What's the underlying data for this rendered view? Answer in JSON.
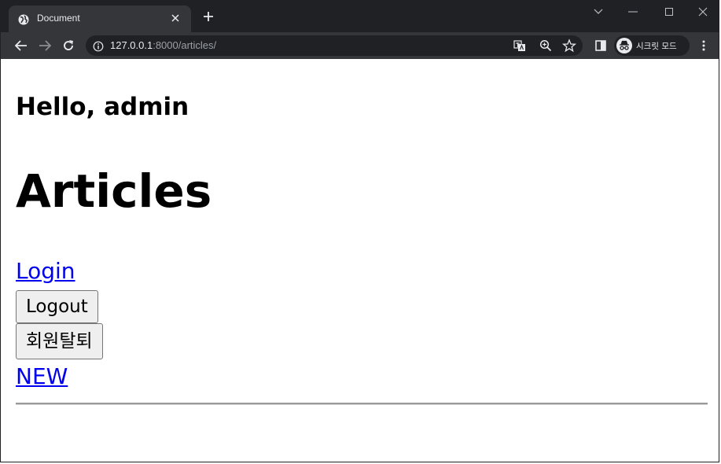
{
  "browser": {
    "tab_title": "Document",
    "url_host": "127.0.0.1",
    "url_rest": ":8000/articles/",
    "profile_label": "시크릿 모드",
    "icons": [
      "globe-icon",
      "close-icon",
      "plus-icon",
      "chevron-down-icon",
      "minimize-icon",
      "maximize-icon",
      "close-window-icon",
      "back-arrow-icon",
      "forward-arrow-icon",
      "reload-icon",
      "info-icon",
      "translate-icon",
      "zoom-icon",
      "star-icon",
      "side-panel-icon",
      "incognito-icon",
      "more-vert-icon"
    ],
    "colors": {
      "frame": "#202124",
      "toolbar": "#35363a",
      "text": "#e8eaed"
    }
  },
  "page": {
    "greeting": "Hello, admin",
    "heading": "Articles",
    "login_link": "Login",
    "logout_button": "Logout",
    "withdraw_button": "회원탈퇴",
    "new_link": "NEW",
    "link_color": "#0000ee"
  }
}
